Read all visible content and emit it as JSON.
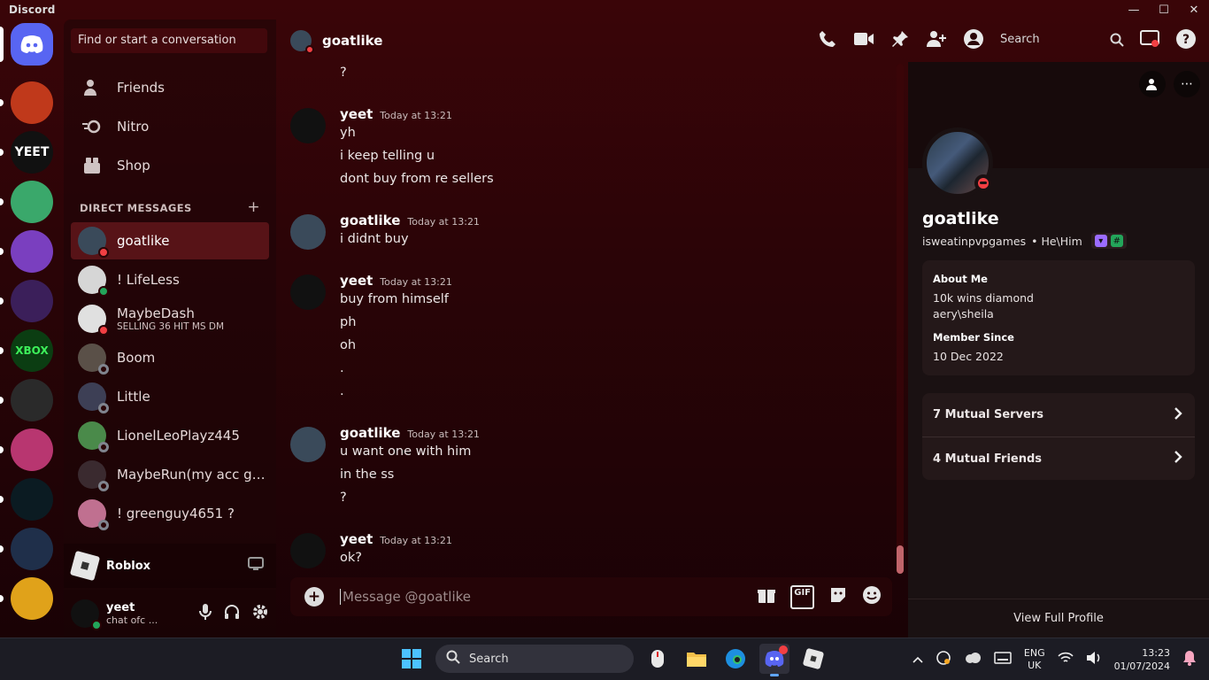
{
  "window": {
    "title": "Discord",
    "controls": [
      "—",
      "☐",
      "✕"
    ]
  },
  "servers": [
    {
      "name": "home",
      "label": "",
      "color": "#5865f2"
    },
    {
      "name": "server-fire",
      "label": "",
      "color": "#c0391b"
    },
    {
      "name": "server-yeet",
      "label": "YEET",
      "color": "#111111"
    },
    {
      "name": "server-kirby",
      "label": "",
      "color": "#3aa86b"
    },
    {
      "name": "server-rainbow",
      "label": "",
      "color": "#7a3fbf"
    },
    {
      "name": "server-mew",
      "label": "",
      "color": "#3b1f5a"
    },
    {
      "name": "server-xbox",
      "label": "XBOX",
      "color": "#0b3d12"
    },
    {
      "name": "server-ghost",
      "label": "",
      "color": "#2a2a2a"
    },
    {
      "name": "server-pink",
      "label": "",
      "color": "#b83670"
    },
    {
      "name": "server-c",
      "label": "",
      "color": "#0b1b22"
    },
    {
      "name": "server-blue",
      "label": "",
      "color": "#1f2f4a"
    },
    {
      "name": "server-yellow",
      "label": "",
      "color": "#e0a21a"
    }
  ],
  "sidebar": {
    "search_placeholder": "Find or start a conversation",
    "nav": [
      {
        "label": "Friends",
        "icon": "friends-icon"
      },
      {
        "label": "Nitro",
        "icon": "nitro-icon"
      },
      {
        "label": "Shop",
        "icon": "shop-icon"
      }
    ],
    "dm_header": "DIRECT MESSAGES",
    "dm_add": "+",
    "dms": [
      {
        "name": "goatlike",
        "status": "dnd",
        "sub": "",
        "active": true,
        "color": "#3a4a5a"
      },
      {
        "name": "! LifeLess",
        "status": "online",
        "sub": "",
        "active": false,
        "color": "#d6d6d6"
      },
      {
        "name": "MaybeDash",
        "status": "dnd",
        "sub": "SELLING 36 HIT MS DM",
        "active": false,
        "color": "#e0e0e0"
      },
      {
        "name": "Boom",
        "status": "offline",
        "sub": "",
        "active": false,
        "color": "#5a5048"
      },
      {
        "name": "Little",
        "status": "offline",
        "sub": "",
        "active": false,
        "color": "#3d3f55"
      },
      {
        "name": "LionelLeoPlayz445",
        "status": "offline",
        "sub": "",
        "active": false,
        "color": "#4a8a4a"
      },
      {
        "name": "MaybeRun(my acc got...",
        "status": "offline",
        "sub": "",
        "active": false,
        "color": "#3a2a2f"
      },
      {
        "name": "! greenguy4651 ?",
        "status": "offline",
        "sub": "",
        "active": false,
        "color": "#c07090"
      }
    ],
    "activity": {
      "name": "Roblox"
    },
    "user": {
      "name": "yeet",
      "status": "chat ofc ..."
    }
  },
  "chat": {
    "channel_name": "goatlike",
    "search_placeholder": "Search",
    "composer_placeholder": "Message @goatlike",
    "messages": [
      {
        "type": "line",
        "text": "?"
      },
      {
        "type": "head",
        "author": "yeet",
        "time": "Today at 13:21"
      },
      {
        "type": "line",
        "text": "yh"
      },
      {
        "type": "line",
        "text": "i keep telling u"
      },
      {
        "type": "line",
        "text": "dont buy from re sellers"
      },
      {
        "type": "head",
        "author": "goatlike",
        "time": "Today at 13:21"
      },
      {
        "type": "line",
        "text": "i didnt buy"
      },
      {
        "type": "head",
        "author": "yeet",
        "time": "Today at 13:21"
      },
      {
        "type": "line",
        "text": "buy from himself"
      },
      {
        "type": "line",
        "text": "ph"
      },
      {
        "type": "line",
        "text": "oh"
      },
      {
        "type": "line",
        "text": "."
      },
      {
        "type": "line",
        "text": "."
      },
      {
        "type": "head",
        "author": "goatlike",
        "time": "Today at 13:21"
      },
      {
        "type": "line",
        "text": "u want one with him"
      },
      {
        "type": "line",
        "text": "in the ss"
      },
      {
        "type": "line",
        "text": "?"
      },
      {
        "type": "head",
        "author": "yeet",
        "time": "Today at 13:21"
      },
      {
        "type": "line",
        "text": "ok?"
      }
    ]
  },
  "profile": {
    "name": "goatlike",
    "username": "isweatinpvpgames",
    "pronouns": "• He\\Him",
    "about_title": "About Me",
    "about_lines": [
      "10k wins diamond",
      "aery\\sheila"
    ],
    "member_title": "Member Since",
    "member_since": "10 Dec 2022",
    "mutual_servers": "7 Mutual Servers",
    "mutual_friends": "4 Mutual Friends",
    "view_full": "View Full Profile"
  },
  "taskbar": {
    "search": "Search",
    "lang_top": "ENG",
    "lang_bottom": "UK",
    "time": "13:23",
    "date": "01/07/2024"
  }
}
